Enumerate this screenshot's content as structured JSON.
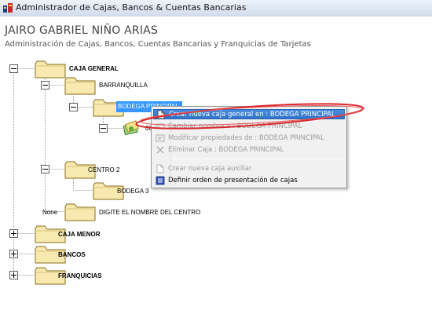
{
  "window": {
    "title": "Administrador de Cajas, Bancos & Cuentas Bancarias"
  },
  "header": {
    "user_name": "JAIRO GABRIEL NIÑO ARIAS",
    "subtitle": "Administración de Cajas, Bancos, Cuentas Bancarias y Franquicias de Tarjetas"
  },
  "tree": {
    "caja_general": "CAJA GENERAL",
    "barranquilla": "BARRANQUILLA",
    "bodega_principal": "BODEGA PRINCIPAL",
    "sub_item_partial": "00",
    "centro_2": "CENTRO 2",
    "bodega_3": "BODEGA 3",
    "none_label": "None",
    "digite_centro": "DIGITE EL NOMBRE DEL CENTRO",
    "caja_menor": "CAJA MENOR",
    "bancos": "BANCOS",
    "franquicias": "FRANQUICIAS"
  },
  "context_menu": {
    "items": [
      {
        "label": "Crear nueva caja general en : BODEGA PRINCIPAL",
        "icon": "new-document-icon",
        "state": "highlighted"
      },
      {
        "label": "Cambiar nombre a : BODEGA PRINCIPAL",
        "icon": "rename-icon",
        "state": "disabled"
      },
      {
        "label": "Modificar propiedades de : BODEGA PRINCIPAL",
        "icon": "properties-icon",
        "state": "disabled"
      },
      {
        "label": "Eliminar Caja : BODEGA PRINCIPAL",
        "icon": "delete-x-icon",
        "state": "disabled"
      },
      {
        "label": "Crear nueva caja auxiliar",
        "icon": "new-document-icon",
        "state": "disabled"
      },
      {
        "label": "Definir orden de presentación de cajas",
        "icon": "order-icon",
        "state": "enabled"
      }
    ]
  },
  "colors": {
    "selection": "#3399ff",
    "folder_fill": "#f7e9b0",
    "folder_stroke": "#8a6d1a",
    "annotation": "#d9262a"
  }
}
